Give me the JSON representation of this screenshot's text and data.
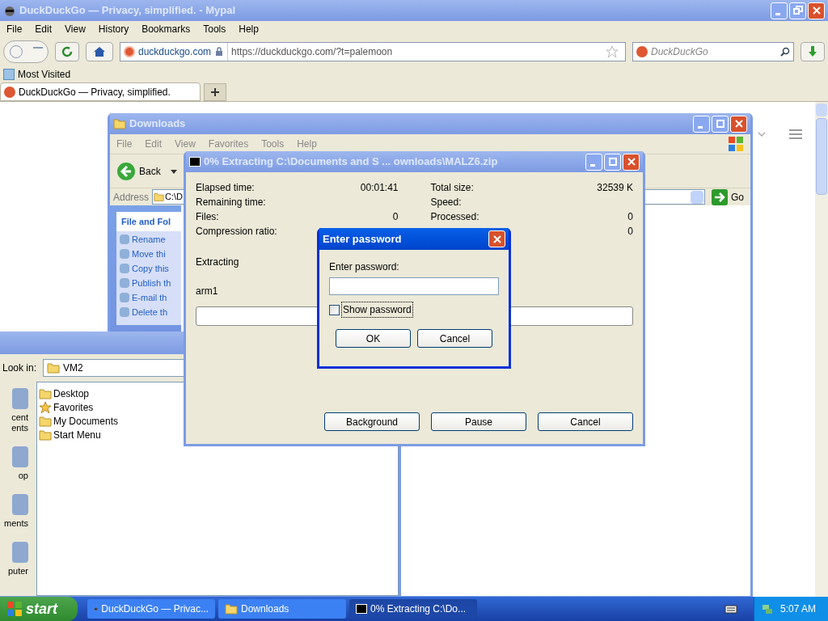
{
  "browser": {
    "title": "DuckDuckGo — Privacy, simplified. - Mypal",
    "menu": [
      "File",
      "Edit",
      "View",
      "History",
      "Bookmarks",
      "Tools",
      "Help"
    ],
    "identity": "duckduckgo.com",
    "url": "https://duckduckgo.com/?t=palemoon",
    "search": {
      "placeholder": "DuckDuckGo"
    },
    "bookmarks": [
      "Most Visited"
    ],
    "tabs": [
      {
        "label": "DuckDuckGo — Privacy, simplified.",
        "selected": true
      }
    ]
  },
  "explorer": {
    "title": "Downloads",
    "menu": [
      "File",
      "Edit",
      "View",
      "Favorites",
      "Tools",
      "Help"
    ],
    "back": "Back",
    "address_label": "Address",
    "address": "C:\\D",
    "go": "Go",
    "task_panel_title": "File and Fol",
    "tasks": [
      "Rename",
      "Move thi",
      "Copy this",
      "Publish th",
      "E-mail th",
      "Delete th"
    ]
  },
  "file_dialog": {
    "look_in_label": "Look in:",
    "look_in": "VM2",
    "places": [
      {
        "lines": [
          "cent",
          "ents"
        ]
      },
      {
        "lines": [
          "op"
        ]
      },
      {
        "lines": [
          "ments"
        ]
      },
      {
        "lines": [
          "puter"
        ]
      }
    ],
    "items": [
      {
        "name": "Desktop",
        "kind": "folder"
      },
      {
        "name": "Favorites",
        "kind": "favorites"
      },
      {
        "name": "My Documents",
        "kind": "folder"
      },
      {
        "name": "Start Menu",
        "kind": "folder"
      }
    ]
  },
  "extract": {
    "title": "0% Extracting C:\\Documents and S ... ownloads\\MALZ6.zip",
    "stats_left": [
      {
        "label": "Elapsed time:",
        "value": "00:01:41"
      },
      {
        "label": "Remaining time:"
      },
      {
        "label": "Files:",
        "value": "0"
      },
      {
        "label": "Compression ratio:"
      }
    ],
    "stats_right": [
      {
        "label": "Total size:",
        "value": "32539 K"
      },
      {
        "label": "Speed:"
      },
      {
        "label": "Processed:",
        "value": "0"
      },
      {
        "value": "0"
      }
    ],
    "stage": "Extracting",
    "file": "arm1",
    "progress": {
      "level": 0
    },
    "buttons": [
      "Background",
      "Pause",
      "Cancel"
    ]
  },
  "password": {
    "title": "Enter password",
    "label": "Enter password:",
    "show_password": {
      "label": "Show password",
      "checked": false
    },
    "buttons": [
      "OK",
      "Cancel"
    ]
  },
  "taskbar": {
    "start": "start",
    "tasks": [
      {
        "label": "DuckDuckGo — Privac...",
        "kind": "browser",
        "selected": false
      },
      {
        "label": "Downloads",
        "kind": "folder",
        "selected": false
      },
      {
        "label": "0% Extracting C:\\Do...",
        "kind": "archive",
        "selected": true
      }
    ],
    "clock": "5:07 AM"
  }
}
